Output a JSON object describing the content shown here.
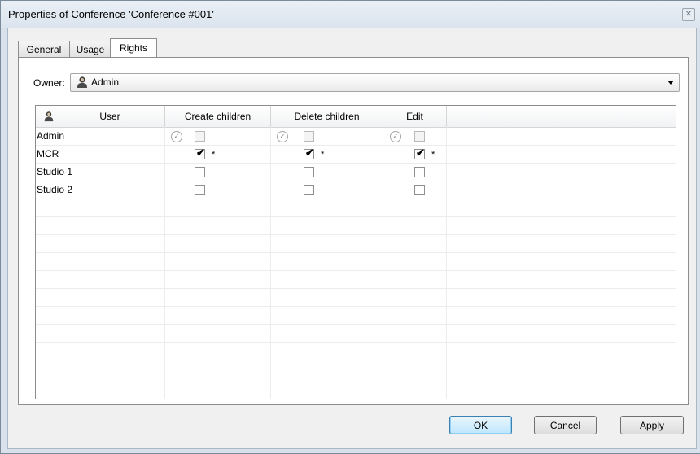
{
  "window": {
    "title": "Properties of Conference 'Conference #001'"
  },
  "tabs": [
    {
      "label": "General",
      "active": false
    },
    {
      "label": "Usage",
      "active": false
    },
    {
      "label": "Rights",
      "active": true
    }
  ],
  "owner": {
    "label": "Owner:",
    "value": "Admin",
    "icon": "user-icon"
  },
  "grid": {
    "columns": [
      "User",
      "Create children",
      "Delete children",
      "Edit"
    ],
    "rows": [
      {
        "user": "Admin",
        "create_children": {
          "inherited": true,
          "checked": false
        },
        "delete_children": {
          "inherited": true,
          "checked": false
        },
        "edit": {
          "inherited": true,
          "checked": false
        }
      },
      {
        "user": "MCR",
        "create_children": {
          "checked": true,
          "mark": "*"
        },
        "delete_children": {
          "checked": true,
          "mark": "*"
        },
        "edit": {
          "checked": true,
          "mark": "*"
        }
      },
      {
        "user": "Studio 1",
        "create_children": {
          "checked": false
        },
        "delete_children": {
          "checked": false
        },
        "edit": {
          "checked": false
        }
      },
      {
        "user": "Studio 2",
        "create_children": {
          "checked": false
        },
        "delete_children": {
          "checked": false
        },
        "edit": {
          "checked": false
        }
      }
    ]
  },
  "buttons": {
    "ok": "OK",
    "cancel": "Cancel",
    "apply": "Apply"
  },
  "colors": {
    "accent": "#3c7fb1",
    "window_frame": "#d9e2ec"
  }
}
